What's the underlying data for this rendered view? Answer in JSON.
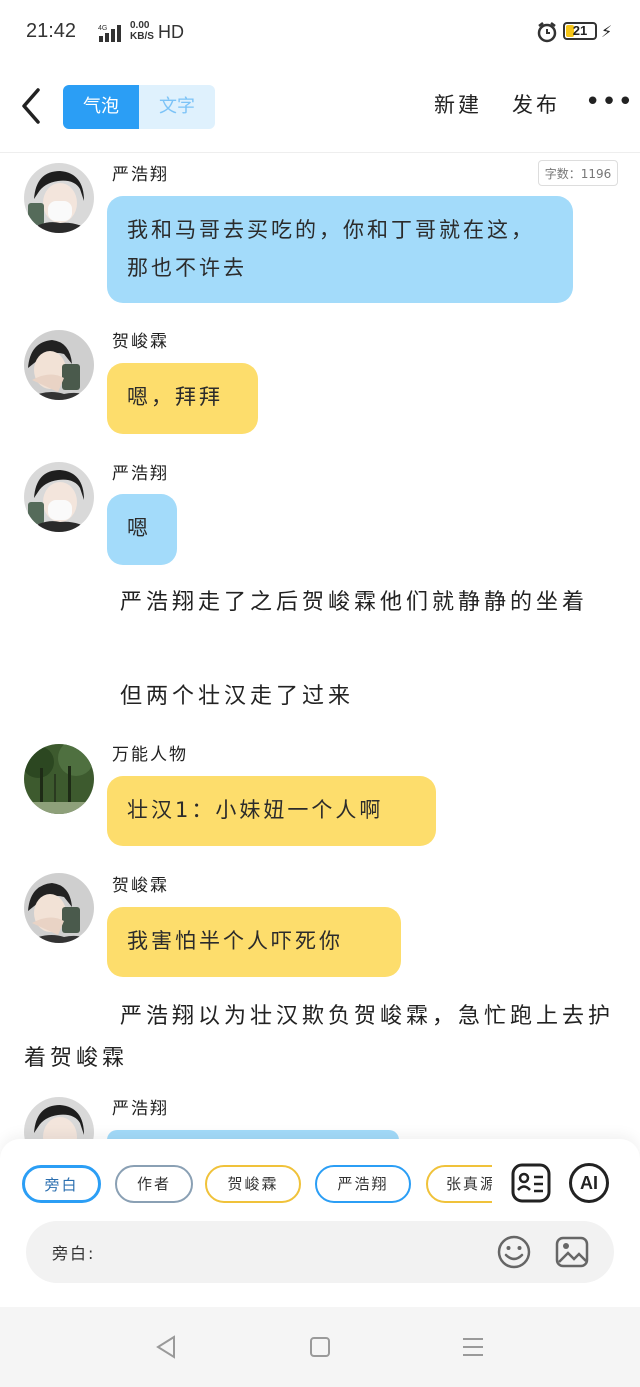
{
  "status_bar": {
    "time": "21:42",
    "network": "4G",
    "speed_value": "0.00",
    "speed_unit": "KB/S",
    "hd": "HD",
    "battery": "21"
  },
  "header": {
    "tab_bubble": "气泡",
    "tab_text": "文字",
    "new_label": "新建",
    "publish_label": "发布",
    "more_label": "•••"
  },
  "word_count": "字数：1196",
  "messages": [
    {
      "name": "严浩翔",
      "text": "我和马哥去买吃的，你和丁哥就在这，那也不许去"
    },
    {
      "name": "贺峻霖",
      "text": "嗯，拜拜"
    },
    {
      "name": "严浩翔",
      "text": "嗯"
    },
    {
      "name": "万能人物",
      "text": "壮汉1：小妹妞一个人啊"
    },
    {
      "name": "贺峻霖",
      "text": "我害怕半个人吓死你"
    },
    {
      "name": "严浩翔",
      "text": ""
    }
  ],
  "narrations": [
    "严浩翔走了之后贺峻霖他们就静静的坐着",
    "但两个壮汉走了过来",
    "严浩翔以为壮汉欺负贺峻霖，急忙跑上去护着贺峻霖"
  ],
  "role_chips": [
    "旁白",
    "作者",
    "贺峻霖",
    "严浩翔",
    "张真源"
  ],
  "ai_label": "AI",
  "input": {
    "label": "旁白:"
  },
  "colors": {
    "accent": "#2b9ef5",
    "bubble_blue": "#a3dbfa",
    "bubble_yellow": "#fddd6c"
  }
}
